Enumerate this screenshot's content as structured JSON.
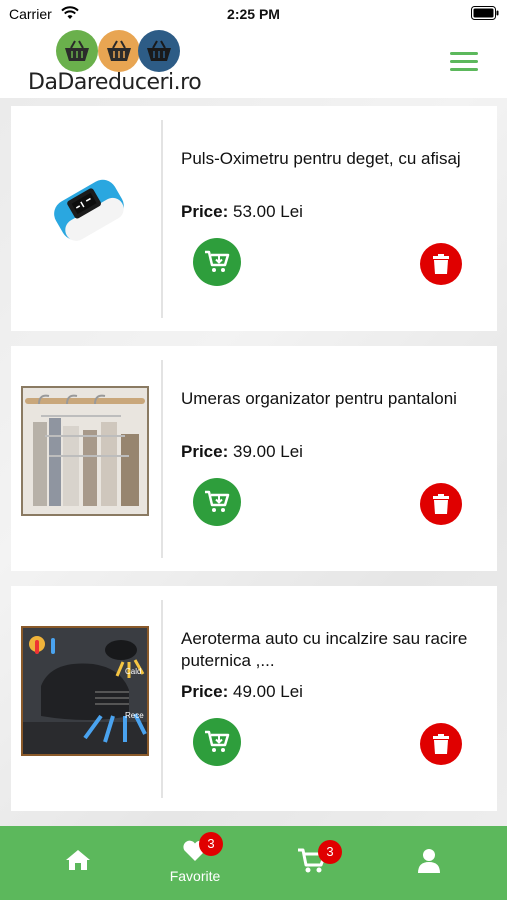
{
  "status_bar": {
    "carrier": "Carrier",
    "time": "2:25 PM",
    "wifi_icon": "wifi-icon",
    "battery_icon": "battery-icon"
  },
  "header": {
    "logo_text": "DaDareduceri.ro",
    "menu_icon": "hamburger-menu-icon",
    "accent_color": "#5cb85c"
  },
  "products": [
    {
      "title": "Puls-Oximetru pentru deget, cu afisaj",
      "price_label": "Price:",
      "price_value": "53.00 Lei",
      "image": "pulse-oximeter-image"
    },
    {
      "title": "Umeras organizator pentru pantaloni",
      "price_label": "Price:",
      "price_value": "39.00 Lei",
      "image": "pants-hanger-organizer-image"
    },
    {
      "title": "Aeroterma auto cu incalzire sau racire puternica ,...",
      "price_label": "Price:",
      "price_value": "49.00 Lei",
      "image": "car-heater-image",
      "image_text_hot": "Cald",
      "image_text_cold": "Rece"
    }
  ],
  "bottom_nav": {
    "items": [
      {
        "icon": "home-icon",
        "label": ""
      },
      {
        "icon": "heart-icon",
        "label": "Favorite",
        "badge": "3"
      },
      {
        "icon": "cart-icon",
        "label": "",
        "badge": "3"
      },
      {
        "icon": "user-icon",
        "label": ""
      }
    ],
    "background_color": "#5cb85c",
    "badge_color": "#e00000"
  },
  "colors": {
    "cart_button": "#2e9e3c",
    "delete_button": "#e00000"
  }
}
